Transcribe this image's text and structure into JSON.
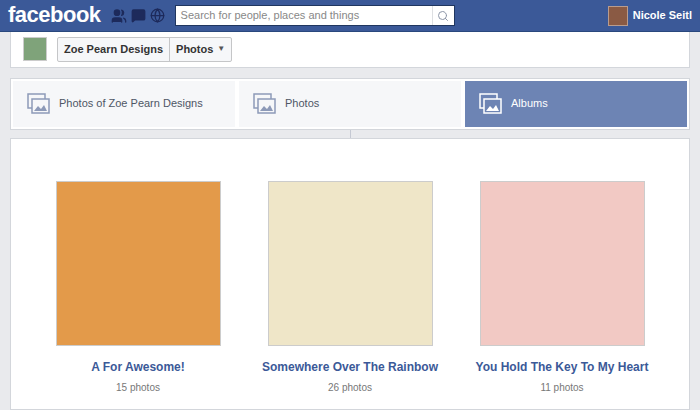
{
  "topbar": {
    "logo": "facebook",
    "search": {
      "placeholder": "Search for people, places and things"
    },
    "user": {
      "name": "Nicole Seitl"
    }
  },
  "page_header": {
    "page_name": "Zoe Pearn Designs",
    "section": "Photos",
    "dropdown_icon": "▼"
  },
  "tabs": [
    {
      "label": "Photos of Zoe Pearn Designs",
      "selected": false
    },
    {
      "label": "Photos",
      "selected": false
    },
    {
      "label": "Albums",
      "selected": true
    }
  ],
  "albums": [
    {
      "title": "A For Awesome!",
      "count": "15 photos",
      "color": "#e39a4a"
    },
    {
      "title": "Somewhere Over The Rainbow",
      "count": "26 photos",
      "color": "#efe6c8"
    },
    {
      "title": "You Hold The Key To My Heart",
      "count": "11 photos",
      "color": "#f2c9c4"
    }
  ]
}
